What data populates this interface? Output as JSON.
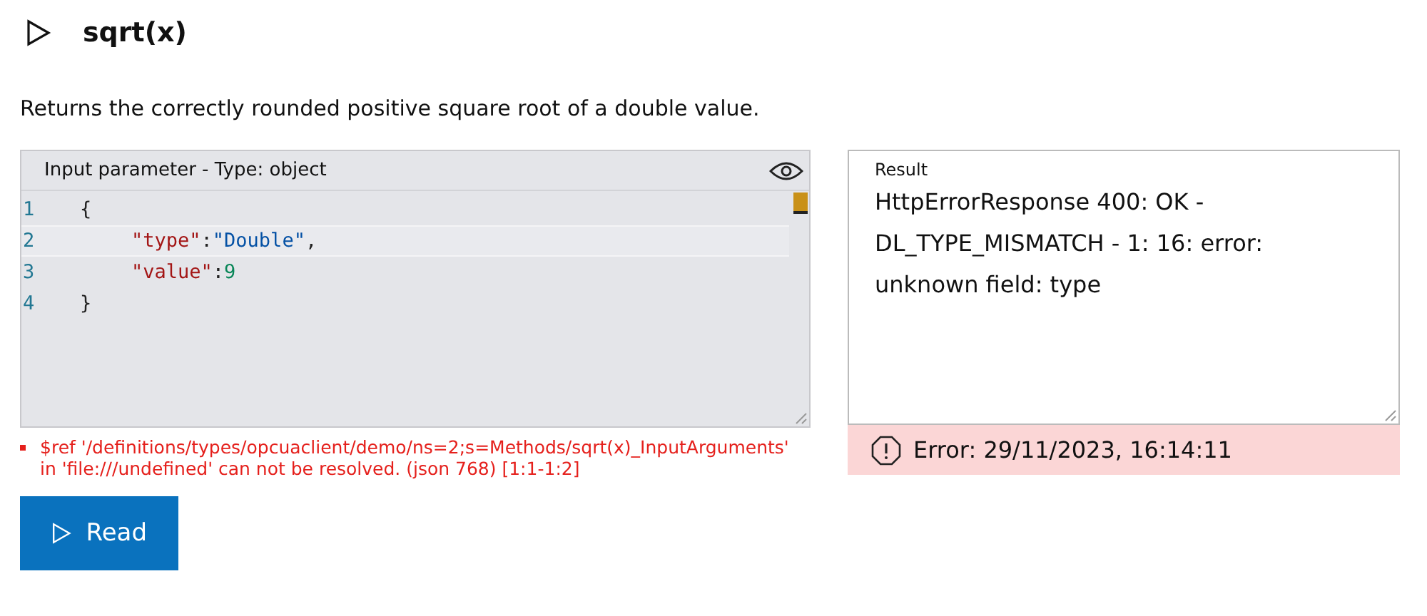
{
  "method": {
    "title": "sqrt(x)",
    "expanded": false
  },
  "description": "Returns the correctly rounded positive square root of a double value.",
  "input_editor": {
    "label": "Input parameter - Type: object",
    "lines": [
      {
        "number": "1",
        "kind": "brace",
        "selected": false,
        "tokens": [
          {
            "text": "{",
            "kind": "punct"
          }
        ]
      },
      {
        "number": "2",
        "kind": "member",
        "selected": true,
        "tokens": [
          {
            "text": "\"type\"",
            "kind": "key"
          },
          {
            "text": ":",
            "kind": "punct"
          },
          {
            "text": "\"Double\"",
            "kind": "string"
          },
          {
            "text": ",",
            "kind": "punct"
          }
        ]
      },
      {
        "number": "3",
        "kind": "member",
        "selected": false,
        "tokens": [
          {
            "text": "\"value\"",
            "kind": "key"
          },
          {
            "text": ":",
            "kind": "punct"
          },
          {
            "text": "9",
            "kind": "number"
          }
        ]
      },
      {
        "number": "4",
        "kind": "brace",
        "selected": false,
        "tokens": [
          {
            "text": "}",
            "kind": "punct"
          }
        ]
      }
    ]
  },
  "validation_errors": [
    "$ref '/definitions/types/opcuaclient/demo/ns=2;s=Methods/sqrt(x)_InputArguments' in 'file:///undefined' can not be resolved. (json 768) [1:1-1:2]"
  ],
  "read_button": {
    "label": "Read"
  },
  "result": {
    "label": "Result",
    "value": "HttpErrorResponse 400: OK - DL_TYPE_MISMATCH - 1: 16: error: unknown field: type",
    "status": "Error: 29/11/2023, 16:14:11"
  }
}
